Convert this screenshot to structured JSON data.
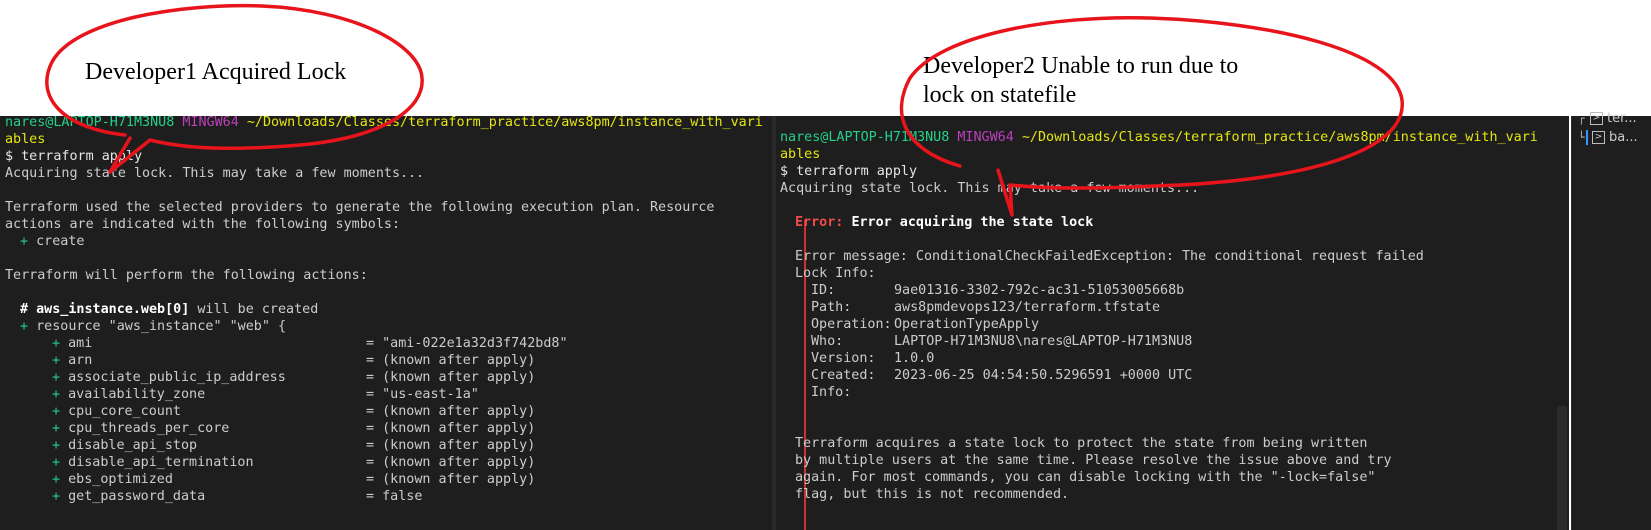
{
  "annotations": {
    "left": "Developer1 Acquired Lock",
    "right_line1": "Developer2 Unable to run due to",
    "right_line2": "lock on statefile",
    "oval_color": "#e8141b"
  },
  "left_terminal": {
    "prompt_user": "nares@LAPTOP-H71M3NU8",
    "prompt_shell": "MINGW64",
    "prompt_path_1": "~/Downloads/Classes/terraform_practice/aws8pm/instance_with_vari",
    "prompt_path_2": "ables",
    "command": "$ terraform apply",
    "lines": {
      "acquiring": "Acquiring state lock. This may take a few moments...",
      "plan1": "Terraform used the selected providers to generate the following execution plan. Resource",
      "plan2": "actions are indicated with the following symbols:",
      "create_sym": "+",
      "create_word": "create",
      "perform": "Terraform will perform the following actions:",
      "res_hash": "#",
      "res_name": "aws_instance.web[0]",
      "res_tail": "will be created",
      "resource_line": "resource \"aws_instance\" \"web\" {"
    },
    "attributes": [
      {
        "name": "ami",
        "value": "= \"ami-022e1a32d3f742bd8\""
      },
      {
        "name": "arn",
        "value": "= (known after apply)"
      },
      {
        "name": "associate_public_ip_address",
        "value": "= (known after apply)"
      },
      {
        "name": "availability_zone",
        "value": "= \"us-east-1a\""
      },
      {
        "name": "cpu_core_count",
        "value": "= (known after apply)"
      },
      {
        "name": "cpu_threads_per_core",
        "value": "= (known after apply)"
      },
      {
        "name": "disable_api_stop",
        "value": "= (known after apply)"
      },
      {
        "name": "disable_api_termination",
        "value": "= (known after apply)"
      },
      {
        "name": "ebs_optimized",
        "value": "= (known after apply)"
      },
      {
        "name": "get_password_data",
        "value": "= false"
      }
    ]
  },
  "right_terminal": {
    "prompt_user": "nares@LAPTOP-H71M3NU8",
    "prompt_shell": "MINGW64",
    "prompt_path_1": "~/Downloads/Classes/terraform_practice/aws8pm/instance_with_vari",
    "prompt_path_2": "ables",
    "command": "$ terraform apply",
    "acquiring": "Acquiring state lock. This may take a few moments...",
    "error_label": "Error:",
    "error_title": "Error acquiring the state lock",
    "error_message": "Error message: ConditionalCheckFailedException: The conditional request failed",
    "lock_info": "Lock Info:",
    "lock_fields": [
      {
        "key": "ID:",
        "value": "9ae01316-3302-792c-ac31-51053005668b"
      },
      {
        "key": "Path:",
        "value": "aws8pmdevops123/terraform.tfstate"
      },
      {
        "key": "Operation:",
        "value": "OperationTypeApply"
      },
      {
        "key": "Who:",
        "value": "LAPTOP-H71M3NU8\\nares@LAPTOP-H71M3NU8"
      },
      {
        "key": "Version:",
        "value": "1.0.0"
      },
      {
        "key": "Created:",
        "value": "2023-06-25 04:54:50.5296591 +0000 UTC"
      },
      {
        "key": "Info:",
        "value": ""
      }
    ],
    "footer": [
      "Terraform acquires a state lock to protect the state from being written",
      "by multiple users at the same time. Please resolve the issue above and try",
      "again. For most commands, you can disable locking with the \"-lock=false\"",
      "flag, but this is not recommended."
    ]
  },
  "side_panel": {
    "items": [
      {
        "label": "ter..."
      },
      {
        "label": "ba..."
      }
    ]
  }
}
